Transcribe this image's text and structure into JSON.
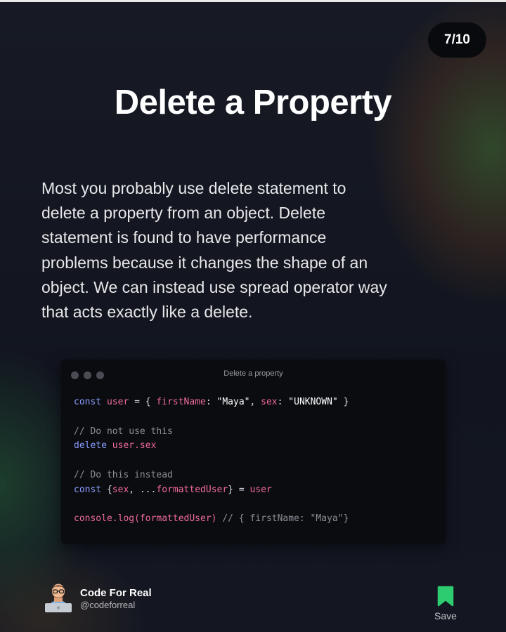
{
  "slide": {
    "counter": "7/10",
    "title": "Delete a Property",
    "body_lines": [
      "Most you probably use delete statement to",
      "delete a property from an object. Delete",
      "statement is found to have performance",
      "problems because it changes the shape of an",
      "object. We can instead use spread operator way",
      "that acts exactly like a delete."
    ]
  },
  "code_window": {
    "title": "Delete a property",
    "lines": {
      "l1": {
        "kw": "const",
        "var1": "user",
        "eq": " = { ",
        "key1": "firstName",
        "c1": ": ",
        "v1": "\"Maya\"",
        "c2": ", ",
        "key2": "sex",
        "c3": ": ",
        "v2": "\"UNKNOWN\"",
        "end": " }"
      },
      "l3": {
        "cmt": "// Do not use this"
      },
      "l4": {
        "kw": "delete",
        "var": "user.sex"
      },
      "l6": {
        "cmt": "// Do this instead"
      },
      "l7": {
        "kw": "const",
        "b1": " {",
        "var1": "sex",
        "mid": ", ...",
        "var2": "formattedUser",
        "b2": "} = ",
        "var3": "user"
      },
      "l9": {
        "var": "console.log(formattedUser)",
        "cmt": " // { firstName: \"Maya\"}"
      }
    }
  },
  "author": {
    "name": "Code For Real",
    "handle": "@codeforreal"
  },
  "save": {
    "label": "Save",
    "icon": "bookmark-icon",
    "color": "#2ecc71"
  },
  "colors": {
    "background": "#121622",
    "keyword": "#8a9eff",
    "variable": "#ee6a9a",
    "comment": "#8d8f98"
  }
}
